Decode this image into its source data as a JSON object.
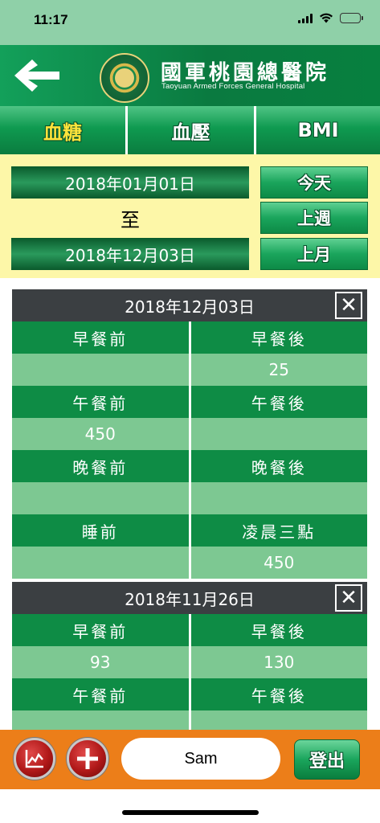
{
  "status_bar": {
    "time": "11:17"
  },
  "header": {
    "hospital_name_zh": "國軍桃園總醫院",
    "hospital_name_en": "Taoyuan Armed Forces General Hospital",
    "logo_icon": "hospital-logo"
  },
  "tabs": [
    {
      "label": "血糖",
      "active": true
    },
    {
      "label": "血壓",
      "active": false
    },
    {
      "label": "BMI",
      "active": false
    }
  ],
  "date_range": {
    "from": "2018年01月01日",
    "separator": "至",
    "to": "2018年12月03日"
  },
  "quick_buttons": {
    "today": "今天",
    "last_week": "上週",
    "last_month": "上月"
  },
  "records": [
    {
      "date": "2018年12月03日",
      "rows": [
        {
          "left_label": "早餐前",
          "right_label": "早餐後",
          "left_value": "",
          "right_value": "25"
        },
        {
          "left_label": "午餐前",
          "right_label": "午餐後",
          "left_value": "450",
          "right_value": ""
        },
        {
          "left_label": "晚餐前",
          "right_label": "晚餐後",
          "left_value": "",
          "right_value": ""
        },
        {
          "left_label": "睡前",
          "right_label": "凌晨三點",
          "left_value": "",
          "right_value": "450"
        }
      ]
    },
    {
      "date": "2018年11月26日",
      "rows": [
        {
          "left_label": "早餐前",
          "right_label": "早餐後",
          "left_value": "93",
          "right_value": "130"
        },
        {
          "left_label": "午餐前",
          "right_label": "午餐後",
          "left_value": "",
          "right_value": ""
        }
      ]
    }
  ],
  "bottom_bar": {
    "chart_icon": "line-chart-icon",
    "add_icon": "plus-icon",
    "user_name": "Sam",
    "logout_label": "登出"
  },
  "colors": {
    "status_bar": "#8fd0a8",
    "header_green": "#0a7a40",
    "active_tab_text": "#ffe33b",
    "date_panel": "#fdf7a8",
    "label_cell": "#0e8c45",
    "value_cell": "#7dc892",
    "card_header": "#3b3f42",
    "bottom_bar": "#ec7e19"
  }
}
